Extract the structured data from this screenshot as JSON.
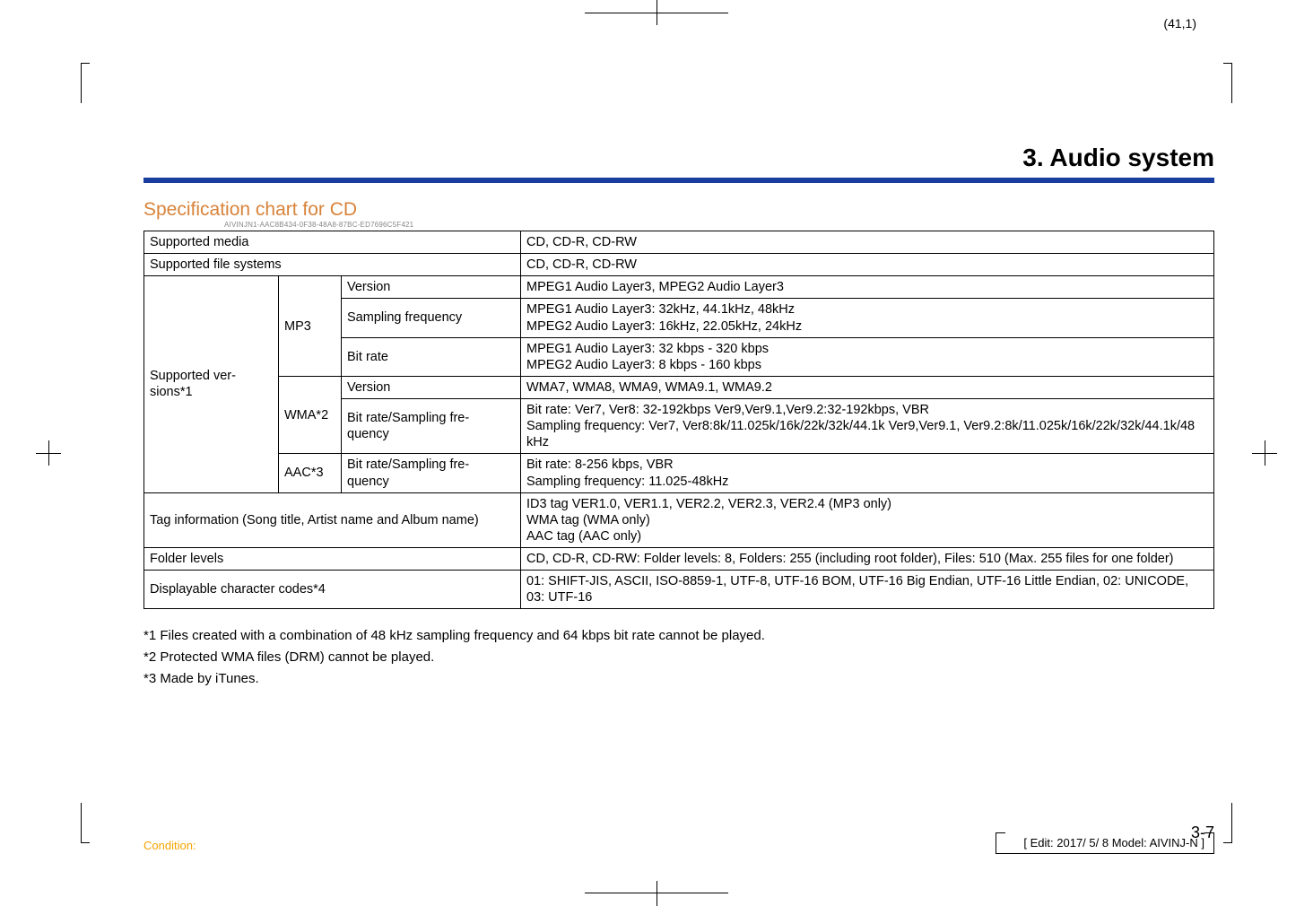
{
  "page_coord": "(41,1)",
  "chapter_title": "3. Audio system",
  "section_title": "Specification chart for CD",
  "doc_id": "AIVINJN1-AAC8B434-0F38-48A8-87BC-ED7696C5F421",
  "table": {
    "row_supported_media_label": "Supported media",
    "row_supported_media_value": "CD, CD-R, CD-RW",
    "row_supported_fs_label": "Supported file systems",
    "row_supported_fs_value": "CD, CD-R, CD-RW",
    "supported_versions_label": "Supported ver-\nsions*1",
    "mp3_label": "MP3",
    "mp3_version_label": "Version",
    "mp3_version_value": "MPEG1 Audio Layer3, MPEG2 Audio Layer3",
    "mp3_sampling_label": "Sampling frequency",
    "mp3_sampling_value": "MPEG1 Audio Layer3: 32kHz, 44.1kHz, 48kHz\nMPEG2 Audio Layer3: 16kHz, 22.05kHz, 24kHz",
    "mp3_bitrate_label": "Bit rate",
    "mp3_bitrate_value": "MPEG1 Audio Layer3: 32 kbps - 320 kbps\nMPEG2 Audio Layer3: 8 kbps - 160 kbps",
    "wma_label": "WMA*2",
    "wma_version_label": "Version",
    "wma_version_value": "WMA7, WMA8, WMA9, WMA9.1, WMA9.2",
    "wma_brsf_label": "Bit rate/Sampling fre-\nquency",
    "wma_brsf_value": "Bit rate: Ver7, Ver8: 32-192kbps Ver9,Ver9.1,Ver9.2:32-192kbps, VBR\nSampling frequency: Ver7, Ver8:8k/11.025k/16k/22k/32k/44.1k Ver9,Ver9.1, Ver9.2:8k/11.025k/16k/22k/32k/44.1k/48 kHz",
    "aac_label": "AAC*3",
    "aac_brsf_label": "Bit rate/Sampling fre-\nquency",
    "aac_brsf_value": "Bit rate: 8-256 kbps, VBR\nSampling frequency: 11.025-48kHz",
    "tag_label": "Tag information (Song title, Artist name and Album name)",
    "tag_value": "ID3 tag VER1.0, VER1.1, VER2.2, VER2.3, VER2.4 (MP3 only)\nWMA tag (WMA only)\nAAC tag (AAC only)",
    "folder_label": "Folder levels",
    "folder_value": "CD, CD-R, CD-RW: Folder levels: 8, Folders: 255 (including root folder), Files: 510 (Max. 255 files for one folder)",
    "charcodes_label": "Displayable character codes*4",
    "charcodes_value": "01: SHIFT-JIS, ASCII, ISO-8859-1, UTF-8, UTF-16 BOM, UTF-16 Big Endian, UTF-16 Little Endian, 02: UNICODE, 03: UTF-16"
  },
  "footnotes": {
    "n1": "*1 Files created with a combination of 48 kHz sampling frequency and 64 kbps bit rate cannot be played.",
    "n2": "*2 Protected WMA files (DRM) cannot be played.",
    "n3": "*3 Made by iTunes."
  },
  "page_number": "3-7",
  "footer_left": "Condition:",
  "footer_right": "Edit: 2017/ 5/ 8   Model:  AIVINJ-N ]"
}
